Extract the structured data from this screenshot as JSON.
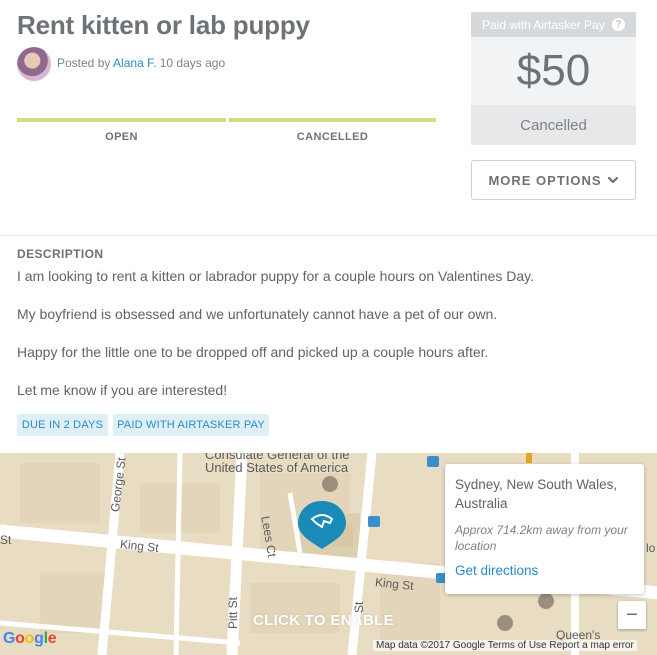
{
  "task": {
    "title": "Rent kitten or lab puppy",
    "posted_prefix": "Posted by ",
    "poster_name": "Alana F.",
    "posted_suffix": " 10 days ago"
  },
  "progress": {
    "steps": [
      "OPEN",
      "CANCELLED"
    ],
    "color": "#cfdf7f"
  },
  "price_panel": {
    "header": "Paid with Airtasker Pay",
    "help_symbol": "?",
    "amount": "$50",
    "status": "Cancelled"
  },
  "more_options": {
    "label": "MORE OPTIONS",
    "icon": "chevron-down-icon"
  },
  "description": {
    "label": "DESCRIPTION",
    "paragraphs": [
      "I am looking to rent a kitten or labrador puppy for a couple hours on Valentines Day.",
      "My boyfriend is obsessed and we unfortunately cannot have a pet of our own.",
      "Happy for the little one to be dropped off and picked up a couple hours after.",
      "Let me know if you are interested!"
    ]
  },
  "tags": [
    "DUE IN 2 DAYS",
    "PAID WITH AIRTASKER PAY"
  ],
  "map": {
    "overlay_text": "CLICK TO ENABLE",
    "street_labels": [
      "George St",
      "King St",
      "King St",
      "Pitt St",
      "Lees Ct",
      "Queen's",
      "St",
      "St",
      "lo"
    ],
    "poi_label_line1": "Consulate General of the",
    "poi_label_line2": "United States of America",
    "logo": "Google",
    "attribution": "Map data ©2017 Google    Terms of Use    Report a map error",
    "zoom_out": "−",
    "pin_color": "#1a8ab8"
  },
  "location_card": {
    "name": "Sydney, New South Wales, Australia",
    "distance": "Approx 714.2km away from your location",
    "directions": "Get directions"
  },
  "colors": {
    "link": "#2a8bc6",
    "tag_bg": "#def0f6",
    "map_block": "#e8dcc3"
  }
}
